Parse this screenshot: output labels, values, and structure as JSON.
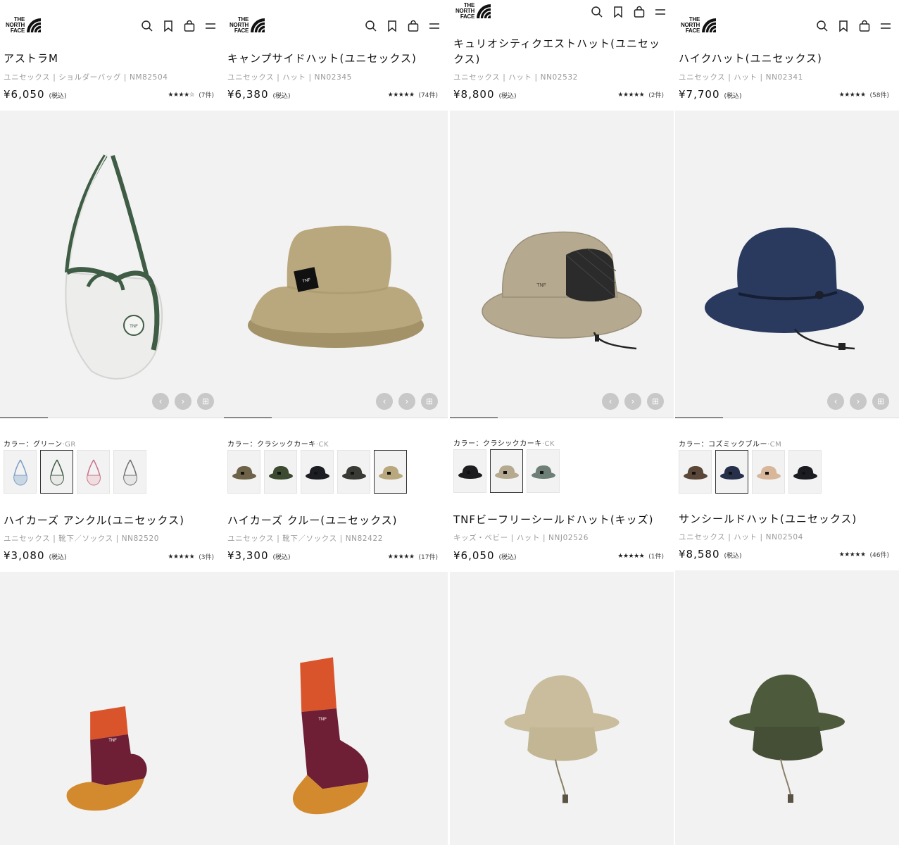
{
  "brand": {
    "logo_lines": [
      "THE",
      "NORTH",
      "FACE"
    ]
  },
  "header_icons": [
    "search-icon",
    "bookmark-icon",
    "cart-icon",
    "menu-icon"
  ],
  "carousel_icons": [
    "chevron-left-icon",
    "chevron-right-icon",
    "grid-icon"
  ],
  "tax_label": "(税込)",
  "color_prefix": "カラー：",
  "columns": [
    {
      "top_product": {
        "title": "アストラM",
        "meta": "ユニセックス | ショルダーバッグ | NM82504",
        "price": "¥6,050",
        "stars": "★★★★☆",
        "reviews": "(7件)",
        "color_name": "グリーン",
        "color_code": "·GR"
      },
      "bottom_product": {
        "title": "ハイカーズ アンクル(ユニセックス)",
        "meta": "ユニセックス | 靴下／ソックス | NN82520",
        "price": "¥3,080",
        "stars": "★★★★★",
        "reviews": "(3件)"
      }
    },
    {
      "top_product": {
        "title": "キャンプサイドハット(ユニセックス)",
        "meta": "ユニセックス | ハット | NN02345",
        "price": "¥6,380",
        "stars": "★★★★★",
        "reviews": "(74件)",
        "color_name": "クラシックカーキ",
        "color_code": "·CK"
      },
      "bottom_product": {
        "title": "ハイカーズ クルー(ユニセックス)",
        "meta": "ユニセックス | 靴下／ソックス | NN82422",
        "price": "¥3,300",
        "stars": "★★★★★",
        "reviews": "(17件)"
      }
    },
    {
      "top_product": {
        "title": "キュリオシティクエストハット(ユニセックス)",
        "meta": "ユニセックス | ハット | NN02532",
        "price": "¥8,800",
        "stars": "★★★★★",
        "reviews": "(2件)",
        "color_name": "クラシックカーキ",
        "color_code": "·CK"
      },
      "bottom_product": {
        "title": "TNFビーフリーシールドハット(キッズ)",
        "meta": "キッズ・ベビー | ハット | NNJ02526",
        "price": "¥6,050",
        "stars": "★★★★★",
        "reviews": "(1件)"
      }
    },
    {
      "top_product": {
        "title": "ハイクハット(ユニセックス)",
        "meta": "ユニセックス | ハット | NN02341",
        "price": "¥7,700",
        "stars": "★★★★★",
        "reviews": "(58件)",
        "color_name": "コズミックブルー",
        "color_code": "·CM"
      },
      "bottom_product": {
        "title": "サンシールドハット(ユニセックス)",
        "meta": "ユニセックス | ハット | NN02504",
        "price": "¥8,580",
        "stars": "★★★★★",
        "reviews": "(46件)"
      }
    }
  ],
  "colors": {
    "image_bg": "#f2f2f2",
    "ctrl_bg": "#c8c8c8",
    "khaki": "#b9a77d",
    "stone": "#b5a98f",
    "navy": "#2a3a5e",
    "olive": "#4e5a3c",
    "sock_orange": "#d9542a",
    "sock_burgundy": "#6e1f35",
    "sock_mustard": "#d38a2e"
  }
}
